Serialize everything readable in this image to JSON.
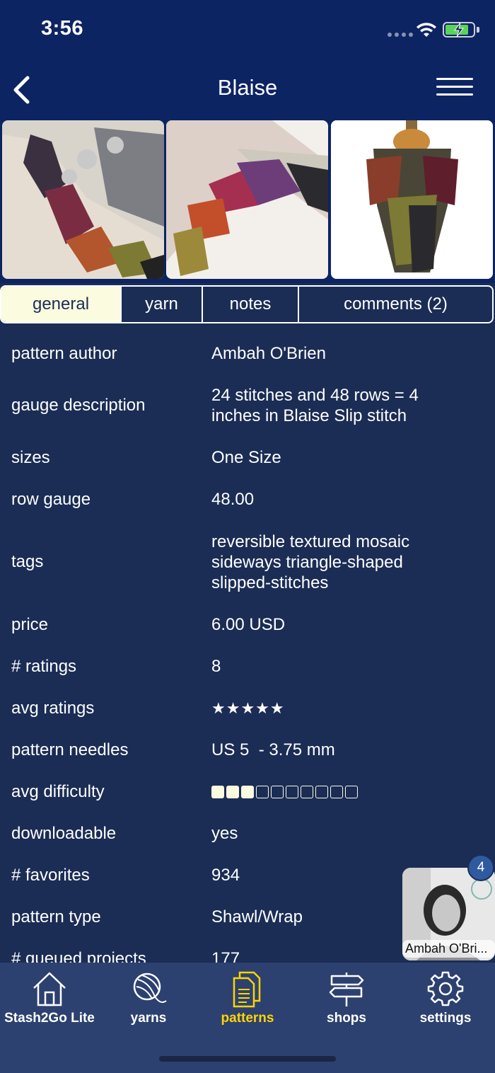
{
  "status_bar": {
    "time": "3:56"
  },
  "nav": {
    "title": "Blaise",
    "back_icon": "chevron-left-icon",
    "menu_icon": "hamburger-menu-icon"
  },
  "tabs": [
    {
      "label": "general",
      "active": true
    },
    {
      "label": "yarn",
      "active": false
    },
    {
      "label": "notes",
      "active": false
    },
    {
      "label": "comments (2)",
      "active": false
    }
  ],
  "details": {
    "pattern_author": {
      "label": "pattern author",
      "value": "Ambah O'Brien"
    },
    "gauge_description": {
      "label": "gauge description",
      "value": "24 stitches and 48 rows = 4 inches in Blaise Slip stitch"
    },
    "sizes": {
      "label": "sizes",
      "value": "One Size"
    },
    "row_gauge": {
      "label": "row gauge",
      "value": "48.00"
    },
    "tags": {
      "label": "tags",
      "value": "reversible textured mosaic sideways triangle-shaped slipped-stitches"
    },
    "price": {
      "label": "price",
      "value": "6.00 USD"
    },
    "num_ratings": {
      "label": "# ratings",
      "value": "8"
    },
    "avg_ratings": {
      "label": "avg ratings",
      "value": "★★★★★",
      "rating": 5,
      "max": 5
    },
    "pattern_needles": {
      "label": "pattern needles",
      "value": "US 5  - 3.75 mm"
    },
    "avg_difficulty": {
      "label": "avg difficulty",
      "level": 3,
      "max": 10
    },
    "downloadable": {
      "label": "downloadable",
      "value": "yes"
    },
    "num_favorites": {
      "label": "# favorites",
      "value": "934"
    },
    "pattern_type": {
      "label": "pattern type",
      "value": "Shawl/Wrap"
    },
    "queued_projects": {
      "label": "# queued projects",
      "value": "177"
    }
  },
  "author_card": {
    "name": "Ambah O'Bri...",
    "badge": "4"
  },
  "bottom_tabs": [
    {
      "label": "Stash2Go Lite",
      "icon": "home-icon",
      "active": false
    },
    {
      "label": "yarns",
      "icon": "yarn-ball-icon",
      "active": false
    },
    {
      "label": "patterns",
      "icon": "patterns-document-icon",
      "active": true
    },
    {
      "label": "shops",
      "icon": "signpost-icon",
      "active": false
    },
    {
      "label": "settings",
      "icon": "gear-icon",
      "active": false
    }
  ],
  "colors": {
    "nav_bg": "#0d2463",
    "page_bg": "#1b2d55",
    "tab_active_bg": "#fbfbe0",
    "tabbar_bg": "#2c4170",
    "active_tab_label": "#ffd400"
  }
}
